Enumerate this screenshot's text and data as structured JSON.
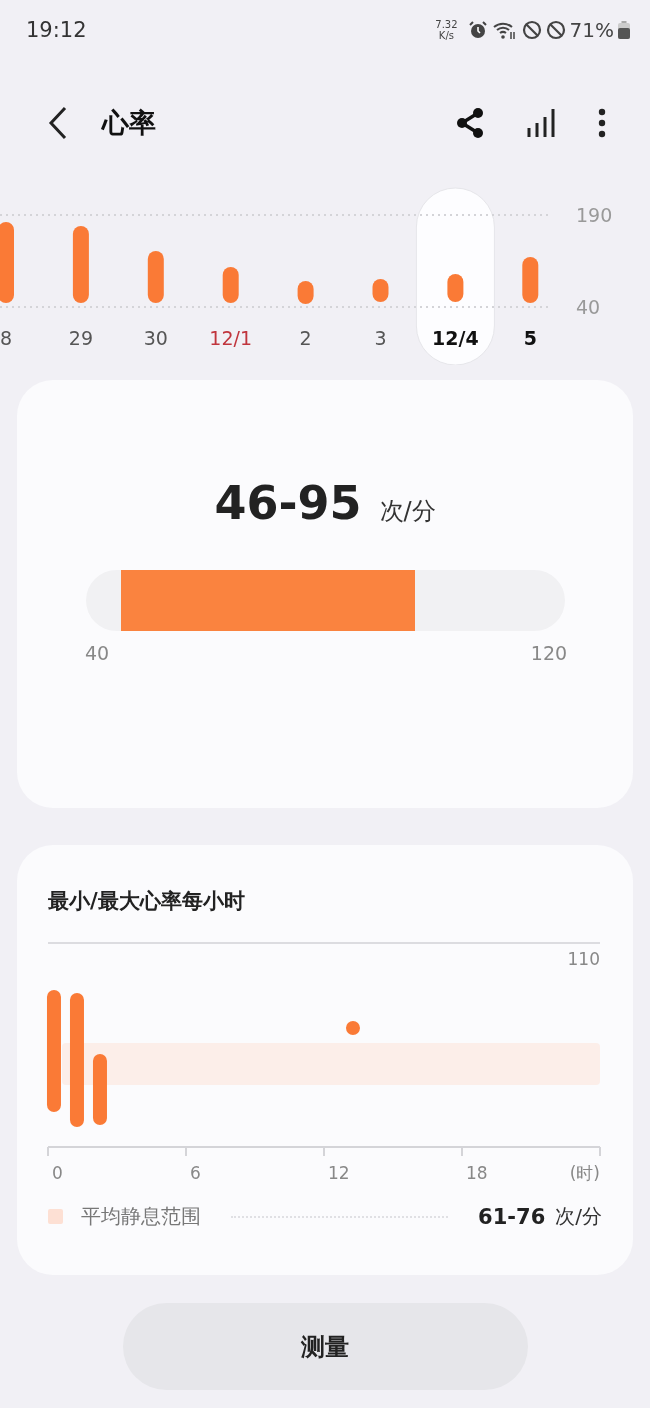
{
  "status_bar": {
    "time": "19:12",
    "net_speed": "7.32",
    "net_unit": "K/s",
    "battery": "71%"
  },
  "header": {
    "title": "心率"
  },
  "daily_chart": {
    "axis_labels": [
      "190",
      "40"
    ],
    "days": [
      {
        "label": "8",
        "selected": false,
        "kind": "normal"
      },
      {
        "label": "29",
        "selected": false,
        "kind": "normal"
      },
      {
        "label": "30",
        "selected": false,
        "kind": "normal"
      },
      {
        "label": "12/1",
        "selected": false,
        "kind": "holiday"
      },
      {
        "label": "2",
        "selected": false,
        "kind": "normal"
      },
      {
        "label": "3",
        "selected": false,
        "kind": "normal"
      },
      {
        "label": "12/4",
        "selected": true,
        "kind": "normal"
      },
      {
        "label": "5",
        "selected": false,
        "kind": "today"
      }
    ]
  },
  "summary": {
    "value": "46-95",
    "unit": "次/分",
    "scale_labels": [
      "40",
      "120"
    ]
  },
  "hourly": {
    "title": "最小/最大心率每小时",
    "y_label": "110",
    "x_labels": [
      "0",
      "6",
      "12",
      "18",
      "(时)"
    ],
    "legend": {
      "label": "平均静息范围",
      "value": "61-76",
      "unit": "次/分",
      "color": "#fde0d4"
    }
  },
  "measure_button": {
    "label": "测量"
  }
}
